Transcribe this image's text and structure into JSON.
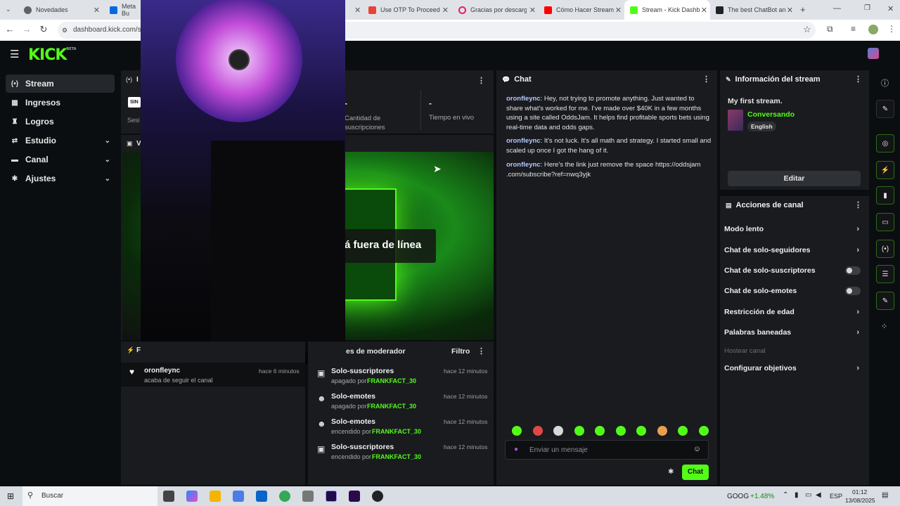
{
  "browser": {
    "tabs": [
      {
        "label": "Novedades",
        "color": "#5f6368"
      },
      {
        "label": "Meta Bu",
        "color": "#0668e1"
      },
      {
        "label": "Use OTP To Proceed",
        "color": "#ea4335"
      },
      {
        "label": "Gracias por descarga",
        "color": "#e91e63"
      },
      {
        "label": "Cómo Hacer Stream",
        "color": "#ff0000"
      },
      {
        "label": "Stream - Kick Dashb",
        "color": "#53fc18"
      },
      {
        "label": "The best ChatBot an",
        "color": "#222222"
      }
    ],
    "url": "dashboard.kick.com/str"
  },
  "sidebar": {
    "items": [
      {
        "label": "Stream",
        "icon": "broadcast-icon"
      },
      {
        "label": "Ingresos",
        "icon": "bank-icon"
      },
      {
        "label": "Logros",
        "icon": "trophy-icon"
      },
      {
        "label": "Estudio",
        "icon": "studio-icon"
      },
      {
        "label": "Canal",
        "icon": "channel-icon"
      },
      {
        "label": "Ajustes",
        "icon": "gear-icon"
      }
    ]
  },
  "stats": {
    "subs_value": "-",
    "subs_label": "Cantidad de suscripciones",
    "live_value": "-",
    "live_label": "Tiempo en vivo",
    "sin_label": "SIN",
    "ses_label": "Sesi"
  },
  "preview": {
    "offline_text": "á fuera de línea"
  },
  "chat": {
    "title": "Chat",
    "messages": [
      {
        "user": "oronfleync",
        "text": ": Hey, not trying to promote anything. Just wanted to share what's worked for me. I've made over $40K in a few months using a site called OddsJam. It helps find profitable sports bets using real-time data and odds gaps."
      },
      {
        "user": "oronfleync",
        "text": ": It's not luck. It's all math and strategy. I started small and scaled up once I got the hang of it."
      },
      {
        "user": "oronfleync",
        "text": ": Here's the link just remove the space https://oddsjam .com/subscribe?ref=nwq3yjk"
      }
    ],
    "input_placeholder": "Enviar un mensaje",
    "send_label": "Chat",
    "emote_colors": [
      "#53fc18",
      "#e04848",
      "#d8d8d8",
      "#53fc18",
      "#53fc18",
      "#53fc18",
      "#53fc18",
      "#e8a050",
      "#53fc18",
      "#53fc18"
    ]
  },
  "streaminfo": {
    "title": "Información del stream",
    "stream_title": "My first stream.",
    "category": "Conversando",
    "language": "English",
    "edit_label": "Editar"
  },
  "actions": {
    "title": "Acciones de canal",
    "items": [
      {
        "label": "Modo lento",
        "type": "chevron"
      },
      {
        "label": "Chat de solo-seguidores",
        "type": "chevron"
      },
      {
        "label": "Chat de solo-suscriptores",
        "type": "toggle"
      },
      {
        "label": "Chat de solo-emotes",
        "type": "toggle"
      },
      {
        "label": "Restricción de edad",
        "type": "chevron"
      },
      {
        "label": "Palabras baneadas",
        "type": "chevron"
      },
      {
        "label": "Hostear canal",
        "type": "disabled"
      },
      {
        "label": "Configurar objetivos",
        "type": "chevron"
      }
    ]
  },
  "activity": {
    "follower": {
      "user": "oronfleync",
      "text": "acaba de seguir el canal",
      "time": "hace 6 minutos"
    },
    "header_f": "F",
    "header_i": "I",
    "header_v": "V"
  },
  "modlog": {
    "title": "es de moderador",
    "filter_label": "Filtro",
    "items": [
      {
        "title": "Solo-suscriptores",
        "state": "apagado por",
        "user": "FRANKFACT_30",
        "time": "hace 12 minutos",
        "icon": "gift-icon"
      },
      {
        "title": "Solo-emotes",
        "state": "apagado por",
        "user": "FRANKFACT_30",
        "time": "hace 12 minutos",
        "icon": "emote-icon"
      },
      {
        "title": "Solo-emotes",
        "state": "encendido por",
        "user": "FRANKFACT_30",
        "time": "hace 12 minutos",
        "icon": "emote-icon"
      },
      {
        "title": "Solo-suscriptores",
        "state": "encendido por",
        "user": "FRANKFACT_30",
        "time": "hace 12 minutos",
        "icon": "gift-icon"
      }
    ]
  },
  "taskbar": {
    "search_label": "Buscar",
    "ticker": "GOOG",
    "ticker_change": "+1.48%",
    "lang": "ESP",
    "time": "01:12",
    "date": "13/08/2025"
  }
}
